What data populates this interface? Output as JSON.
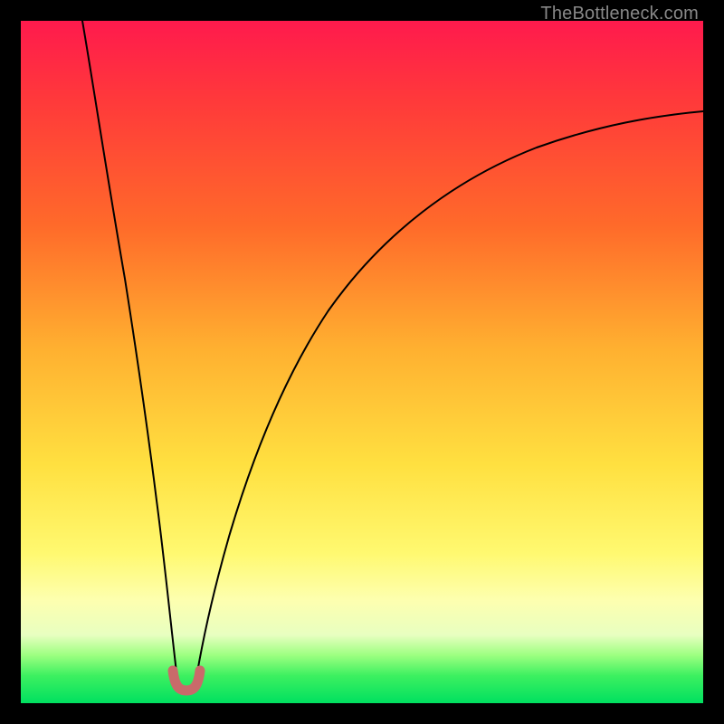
{
  "watermark": "TheBottleneck.com",
  "chart_data": {
    "type": "line",
    "title": "",
    "xlabel": "",
    "ylabel": "",
    "xlim": [
      0,
      100
    ],
    "ylim": [
      0,
      100
    ],
    "grid": false,
    "legend": false,
    "series": [
      {
        "name": "left-branch",
        "x": [
          9,
          10,
          12,
          14,
          16,
          18,
          19,
          20,
          21,
          22,
          23
        ],
        "values": [
          100,
          92,
          77,
          62,
          46,
          30,
          22,
          13,
          6,
          3,
          2
        ]
      },
      {
        "name": "right-branch",
        "x": [
          25,
          26,
          28,
          30,
          34,
          40,
          48,
          58,
          70,
          84,
          100
        ],
        "values": [
          2,
          4,
          10,
          18,
          32,
          48,
          60,
          70,
          77,
          82,
          87
        ]
      },
      {
        "name": "min-marker",
        "x": [
          22,
          23,
          24,
          25,
          26
        ],
        "values": [
          4,
          2,
          2,
          2,
          4
        ]
      }
    ],
    "colors": {
      "curve": "#000000",
      "marker": "#c96a6a",
      "gradient_top": "#ff1a4d",
      "gradient_mid": "#ffe040",
      "gradient_bottom": "#00e060"
    }
  }
}
